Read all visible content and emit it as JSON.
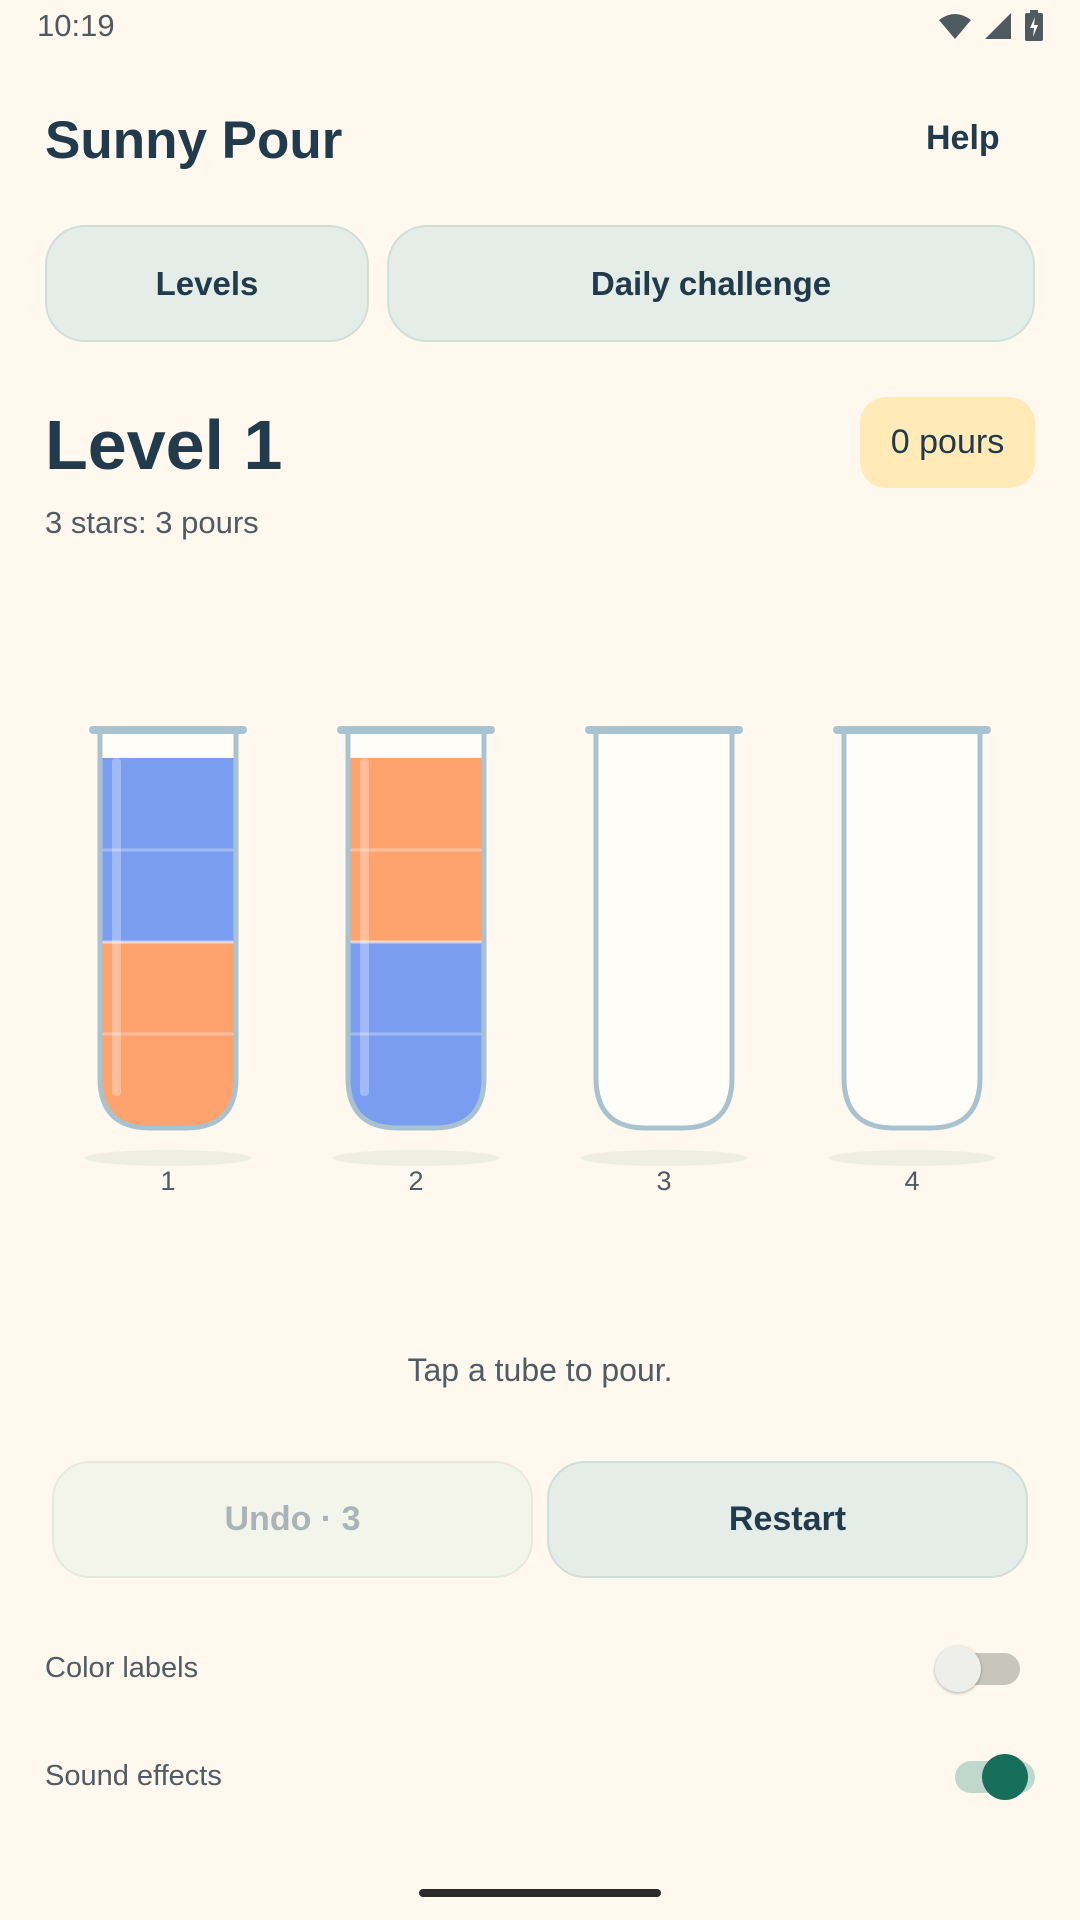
{
  "status_bar": {
    "time": "10:19",
    "icons": [
      "wifi-icon",
      "cell-signal-icon",
      "battery-charging-icon"
    ]
  },
  "header": {
    "title": "Sunny Pour",
    "help_label": "Help"
  },
  "modes": {
    "levels_label": "Levels",
    "daily_label": "Daily challenge"
  },
  "level": {
    "title": "Level 1",
    "star_target": "3 stars: 3 pours",
    "pours_badge": "0 pours"
  },
  "colors": {
    "blue": "#7a9df0",
    "orange": "#ffa36e",
    "tube_outline": "#a9c2cf",
    "accent_green": "#176e5a"
  },
  "tubes": [
    {
      "number": "1",
      "layers": [
        "orange",
        "orange",
        "blue",
        "blue"
      ]
    },
    {
      "number": "2",
      "layers": [
        "blue",
        "blue",
        "orange",
        "orange"
      ]
    },
    {
      "number": "3",
      "layers": []
    },
    {
      "number": "4",
      "layers": []
    }
  ],
  "hint": "Tap a tube to pour.",
  "actions": {
    "undo_label": "Undo · 3",
    "undo_enabled": false,
    "restart_label": "Restart"
  },
  "settings": {
    "color_labels": {
      "label": "Color labels",
      "enabled": false
    },
    "sound_effects": {
      "label": "Sound effects",
      "enabled": true
    }
  }
}
